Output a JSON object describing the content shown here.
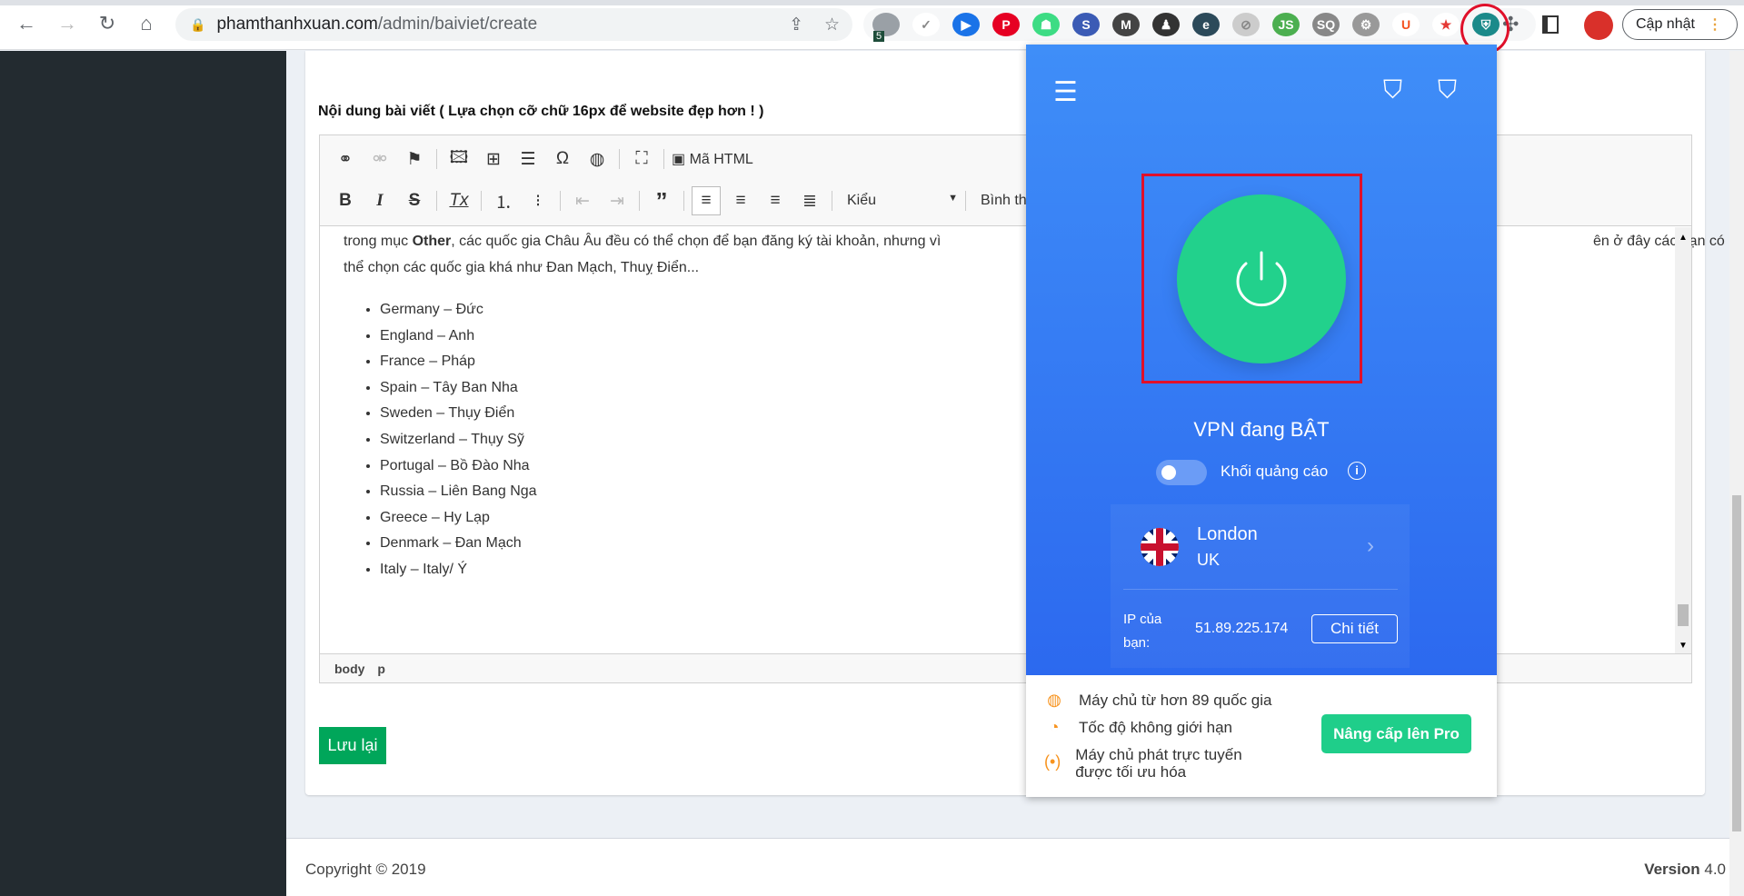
{
  "browser": {
    "url_host": "phamthanhxuan.com",
    "url_path": "/admin/baiviet/create",
    "update_label": "Cập nhật",
    "ext_badge": "5",
    "extensions": [
      {
        "name": "shield-gray-ext",
        "color": "#9aa0a6",
        "label": ""
      },
      {
        "name": "check-ext",
        "color": "#fff",
        "label": "✓"
      },
      {
        "name": "blue-play-ext",
        "color": "#1a73e8",
        "label": "▶"
      },
      {
        "name": "pinterest-ext",
        "color": "#e60023",
        "label": "P"
      },
      {
        "name": "android-ext",
        "color": "#3ddc84",
        "label": "☗"
      },
      {
        "name": "s-ext",
        "color": "#3b5bb5",
        "label": "S"
      },
      {
        "name": "m-ext",
        "color": "#444",
        "label": "M"
      },
      {
        "name": "spy-ext",
        "color": "#333",
        "label": "♟"
      },
      {
        "name": "e-ext",
        "color": "#2c4a5a",
        "label": "e"
      },
      {
        "name": "compass-ext",
        "color": "#ccc",
        "label": "⊘"
      },
      {
        "name": "js-ext",
        "color": "#4caf50",
        "label": "JS"
      },
      {
        "name": "sq-ext",
        "color": "#888",
        "label": "SQ"
      },
      {
        "name": "gear-ext",
        "color": "#999",
        "label": "⚙"
      },
      {
        "name": "u-ext",
        "color": "#fff",
        "label": "U"
      },
      {
        "name": "star-ext",
        "color": "#fff",
        "label": "★"
      },
      {
        "name": "vpn-ext",
        "color": "#1b8a8a",
        "label": "⛨"
      }
    ]
  },
  "form": {
    "content_label": "Nội dung bài viết ( Lựa chọn cỡ chữ 16px để website đẹp hơn ! )",
    "save_label": "Lưu lại"
  },
  "editor": {
    "source_label": "Mã HTML",
    "style_select": "Kiểu",
    "format_select": "Bình thư…",
    "para_before": "trong mục ",
    "para_bold": "Other",
    "para_after": ", các quốc gia Châu Âu đều có thể chọn để bạn đăng ký tài khoản, nhưng vì",
    "para_right": "ên ở đây các bạn có",
    "para_line2": "thể chọn các quốc gia khá như Đan Mạch, Thuỵ Điển...",
    "list": [
      "Germany  – Đức",
      "England – Anh",
      "France – Pháp",
      "Spain – Tây Ban Nha",
      "Sweden – Thụy Điển",
      "Switzerland – Thụy Sỹ",
      "Portugal – Bồ Đào Nha",
      "Russia – Liên Bang Nga",
      "Greece – Hy Lạp",
      "Denmark – Đan Mạch",
      "Italy – Italy/ Ý"
    ],
    "path": [
      "body",
      "p"
    ]
  },
  "footer": {
    "copyright": "Copyright © 2019",
    "version_bold": "Version",
    "version_num": "4.0"
  },
  "vpn": {
    "status": "VPN đang BẬT",
    "adblock_label": "Khối quảng cáo",
    "adblock_on": false,
    "city": "London",
    "country": "UK",
    "ip_label_1": "IP của",
    "ip_label_2": "bạn:",
    "ip": "51.89.225.174",
    "details": "Chi tiết",
    "features": [
      "Máy chủ từ hơn 89 quốc gia",
      "Tốc độ không giới hạn",
      "Máy chủ phát trực tuyến được tối ưu hóa"
    ],
    "upgrade": "Nâng cấp lên Pro",
    "accent": "#22d18c",
    "blue": "#3f8ef8"
  }
}
